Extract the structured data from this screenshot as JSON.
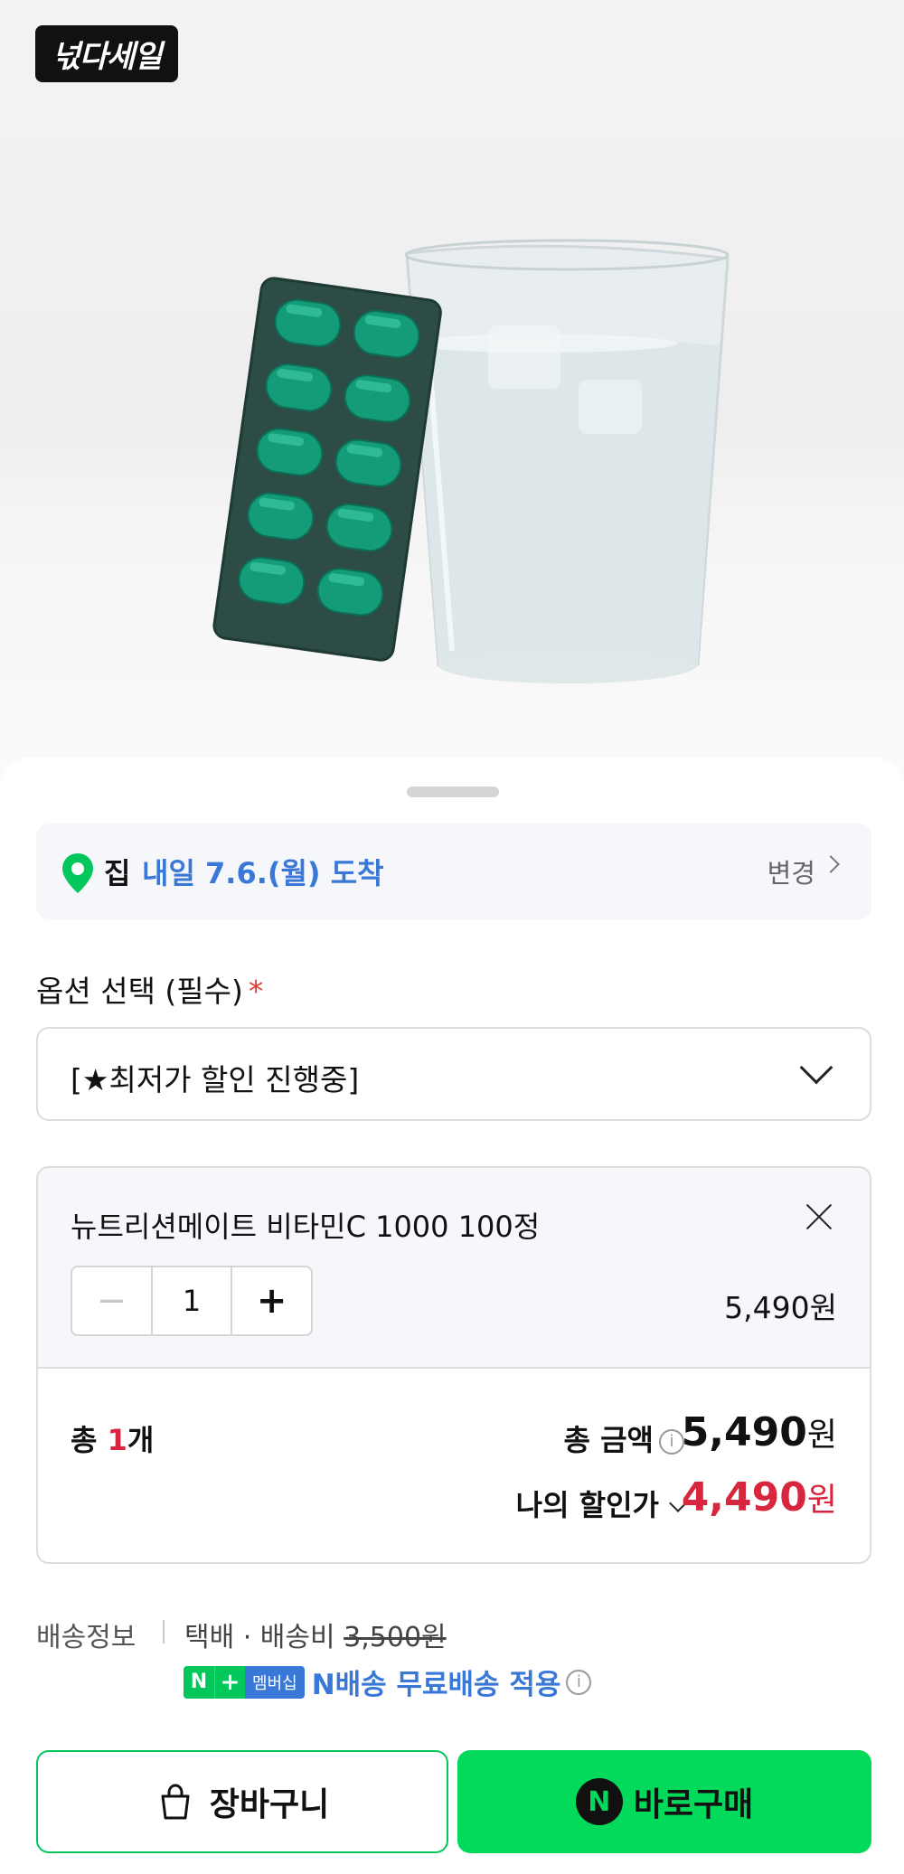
{
  "brand": {
    "badge_text": "넋다세일"
  },
  "delivery": {
    "place": "집",
    "arrival": "내일 7.6.(월) 도착",
    "change_label": "변경",
    "pin_icon": "location-pin-icon",
    "pin_color": "#03c75a"
  },
  "option": {
    "label": "옵션 선택 (필수)",
    "required_mark": "*",
    "selected_value": "[★최저가 할인 진행중]"
  },
  "item": {
    "name": "뉴트리션메이트 비타민C 1000 100정",
    "quantity": "1",
    "minus_label": "−",
    "plus_label": "+",
    "price": "5,490원"
  },
  "totals": {
    "count_prefix": "총 ",
    "count": "1",
    "count_suffix": "개",
    "total_label": "총 금액",
    "total_amount": "5,490",
    "total_unit": "원",
    "my_discount_label": "나의 할인가",
    "my_discount_amount": "4,490",
    "my_discount_unit": "원",
    "discount_color": "#d7263d"
  },
  "shipping": {
    "label": "배송정보",
    "method": "택배 · 배송비 ",
    "fee": "3,500원",
    "badge_n": "N",
    "badge_plus": "+",
    "badge_membership": "멤버십",
    "free_shipping_text": "N배송 무료배송 적용"
  },
  "actions": {
    "cart_label": "장바구니",
    "buy_label": "바로구매",
    "buy_logo": "N",
    "accent": "#03c75a"
  }
}
